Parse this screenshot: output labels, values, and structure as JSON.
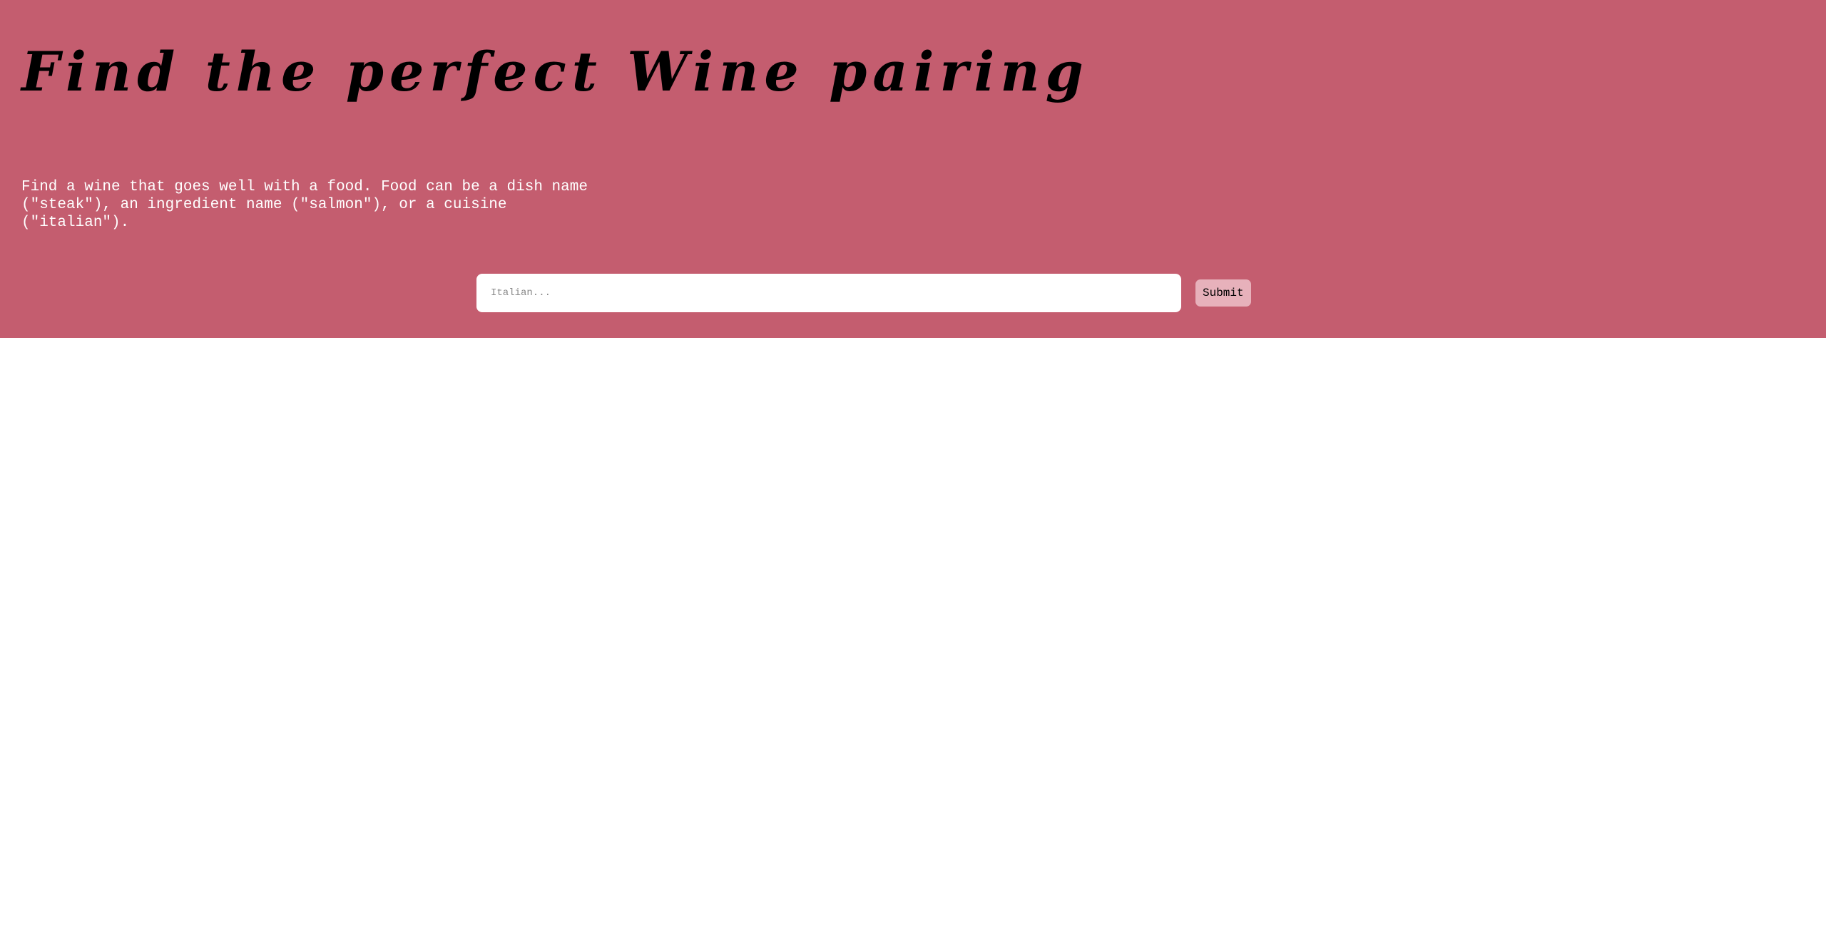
{
  "hero": {
    "title": "Find the perfect Wine pairing",
    "description": "Find a wine that goes well with a food. Food can be a dish name (\"steak\"), an ingredient name (\"salmon\"), or a cuisine (\"italian\")."
  },
  "search": {
    "placeholder": "Italian...",
    "value": "",
    "submit_label": "Submit"
  },
  "colors": {
    "hero_background": "#c45d6f",
    "submit_background": "#e7b1bb",
    "page_background": "#ffffff"
  }
}
